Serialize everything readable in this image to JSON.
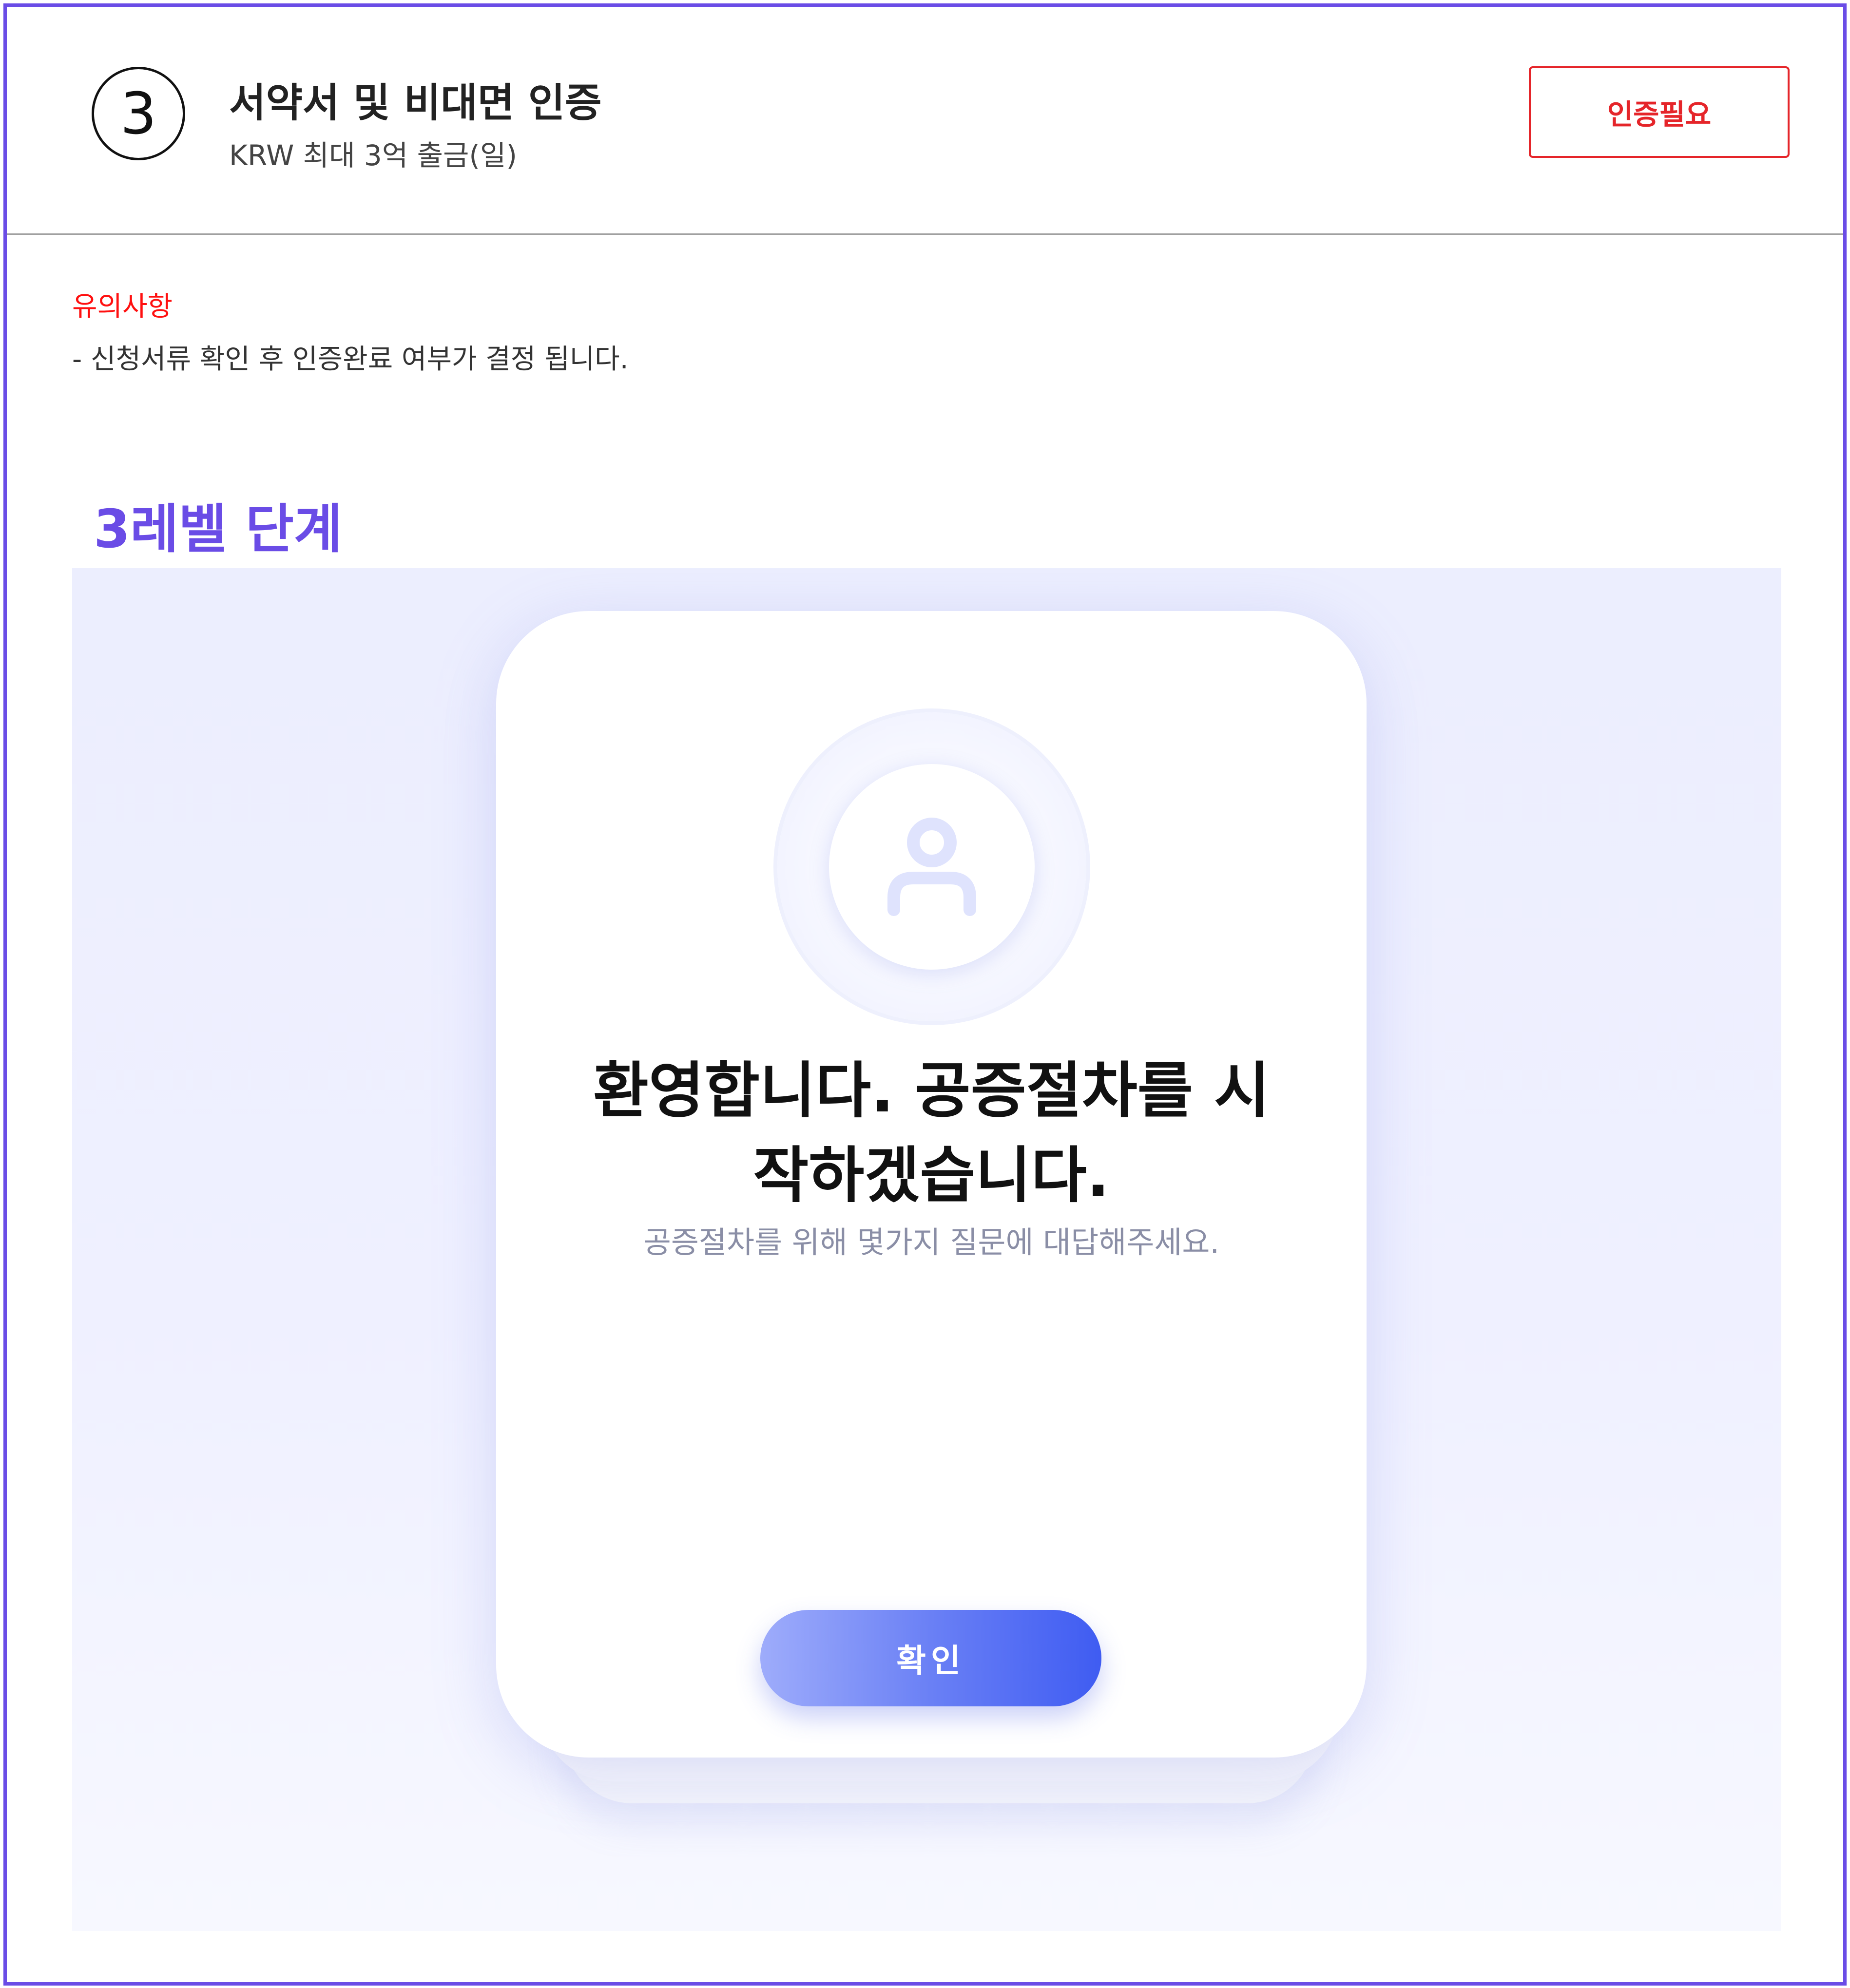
{
  "step": {
    "number": "3",
    "title": "서약서 및 비대면 인증",
    "subtitle": "KRW 최대 3억 출금(일)",
    "status_label": "인증필요"
  },
  "notice": {
    "title": "유의사항",
    "text": "- 신청서류 확인 후 인증완료 여부가 결정 됩니다."
  },
  "level_title": "3레벨 단계",
  "card": {
    "icon": "user-icon",
    "title_line1": "환영합니다. 공증절차를 시",
    "title_line2": "작하겠습니다.",
    "description": "공증절차를 위해 몇가지 질문에 대답해주세요.",
    "confirm_label": "확인"
  },
  "colors": {
    "frame_border": "#6a4ce6",
    "level_title": "#6a4ce6",
    "status_red": "#e5252a",
    "notice_red": "#ff1010",
    "button_gradient_start": "#9eacfb",
    "button_gradient_end": "#3f5cf2"
  }
}
